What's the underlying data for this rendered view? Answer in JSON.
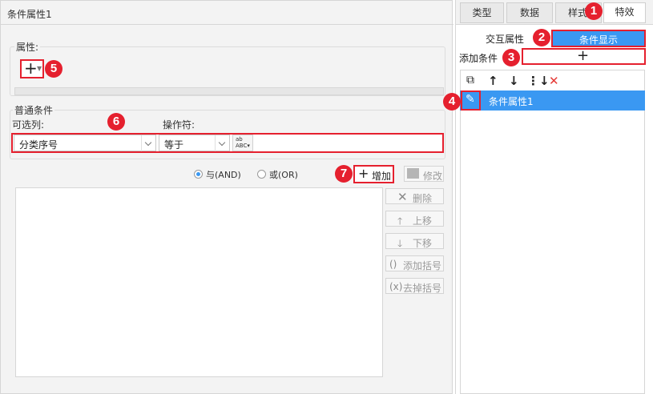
{
  "dialog": {
    "title": "条件属性1",
    "properties_label": "属性:",
    "add_property_label": "+",
    "condition_group_label": "普通条件",
    "column_label": "可选列:",
    "operator_label": "操作符:",
    "column_value": "分类序号",
    "operator_value": "等于",
    "value_input": "",
    "radio_and_label": "与(AND)",
    "radio_or_label": "或(OR)",
    "radio_selected": "and",
    "add_button": "增加",
    "modify_button": "修改",
    "delete_button": "删除",
    "move_up_button": "上移",
    "move_down_button": "下移",
    "add_bracket_button": "添加括号",
    "remove_bracket_button": "去掉括号"
  },
  "right_panel": {
    "tabs": [
      {
        "label": "类型"
      },
      {
        "label": "数据"
      },
      {
        "label": "样式"
      },
      {
        "label": "特效"
      }
    ],
    "active_tab": "特效",
    "subtabs": [
      {
        "label": "交互属性"
      },
      {
        "label": "条件显示"
      }
    ],
    "active_subtab": "条件显示",
    "add_condition_label": "添加条件",
    "add_condition_button": "+",
    "list_items": [
      {
        "label": "条件属性1"
      }
    ]
  },
  "annotations": [
    "1",
    "2",
    "3",
    "4",
    "5",
    "6",
    "7"
  ],
  "colors": {
    "accent": "#3a98f2",
    "annotation_red": "#e5202e",
    "delete_red": "#e53935"
  }
}
